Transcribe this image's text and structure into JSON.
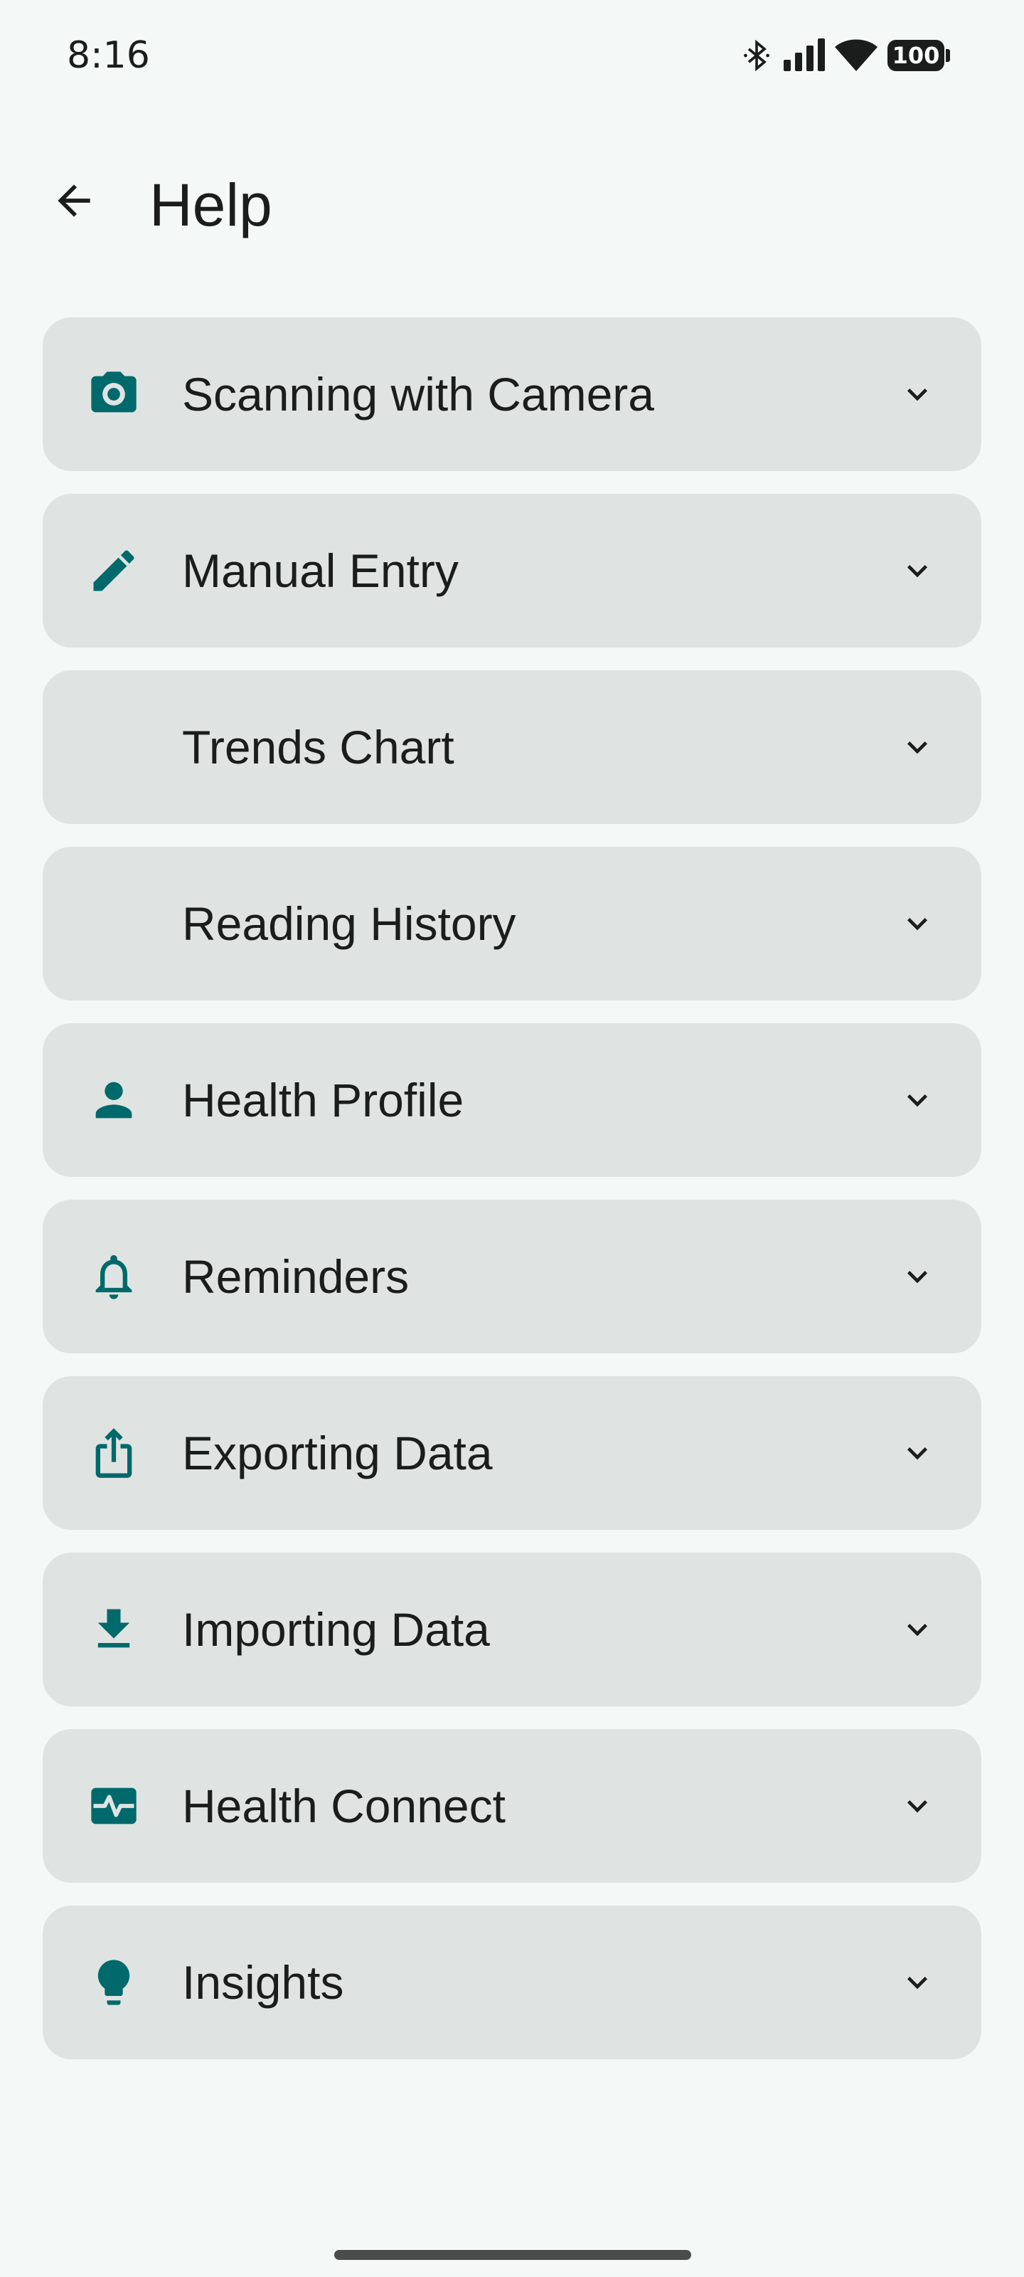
{
  "status_bar": {
    "time": "8:16",
    "battery": "100",
    "icons": [
      "bluetooth-icon",
      "signal-icon",
      "wifi-icon",
      "battery-icon"
    ]
  },
  "header": {
    "title": "Help",
    "back_icon": "arrow-left-icon"
  },
  "colors": {
    "background": "#f4f9f7",
    "card": "#dfe4e2",
    "accent": "#00696b",
    "text": "#1b1d1d"
  },
  "help_topics": [
    {
      "label": "Scanning with Camera",
      "icon": "camera-icon"
    },
    {
      "label": "Manual Entry",
      "icon": "pencil-icon"
    },
    {
      "label": "Trends Chart",
      "icon": ""
    },
    {
      "label": "Reading History",
      "icon": ""
    },
    {
      "label": "Health Profile",
      "icon": "person-icon"
    },
    {
      "label": "Reminders",
      "icon": "bell-icon"
    },
    {
      "label": "Exporting Data",
      "icon": "share-icon"
    },
    {
      "label": "Importing Data",
      "icon": "download-icon"
    },
    {
      "label": "Health Connect",
      "icon": "health-pulse-icon"
    },
    {
      "label": "Insights",
      "icon": "lightbulb-icon"
    }
  ]
}
